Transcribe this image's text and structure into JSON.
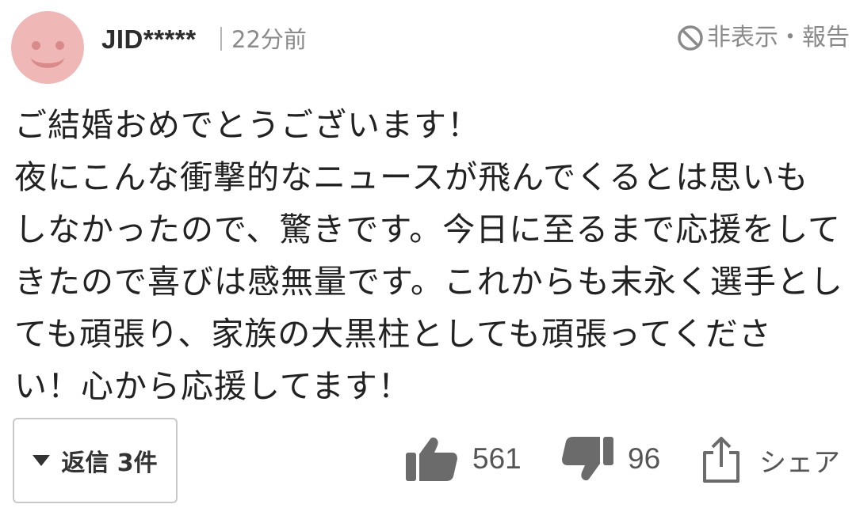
{
  "user": {
    "name": "JID*****",
    "time": "22分前",
    "avatar_icon": "smiley-face-avatar"
  },
  "header": {
    "hide_report_label": "非表示・報告",
    "hide_icon": "ban-icon"
  },
  "comment": {
    "lines": [
      "ご結婚おめでとうございます！",
      "夜にこんな衝撃的なニュースが飛んでくるとは思いも",
      "しなかったので、驚きです。今日に至るまで応援をして",
      "きたので喜びは感無量です。これからも末永く選手とし",
      "ても頑張り、家族の大黒柱としても頑張ってくださ",
      "い！心から応援してます！"
    ]
  },
  "footer": {
    "reply_label": "返信 3件",
    "likes": "561",
    "dislikes": "96",
    "share_label": "シェア"
  },
  "colors": {
    "avatar_bg": "#f0b7b7",
    "avatar_features": "#d98a8a",
    "icon_gray": "#6b6b6b",
    "muted_text": "#8a8a8a"
  }
}
